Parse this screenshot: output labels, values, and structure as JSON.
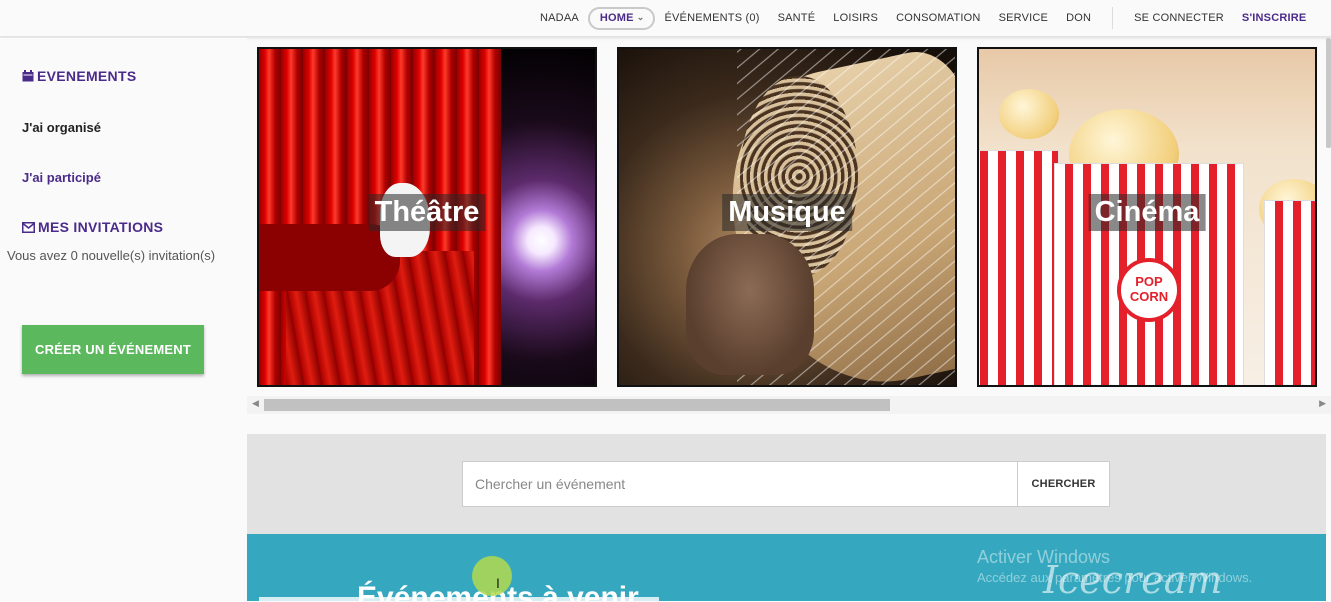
{
  "nav": {
    "brand": "NADAA",
    "home": "HOME",
    "events": "ÉVÉNEMENTS (0)",
    "sante": "SANTÉ",
    "loisirs": "LOISIRS",
    "consomation": "CONSOMATION",
    "service": "SERVICE",
    "don": "DON",
    "login": "SE CONNECTER",
    "signup": "S'INSCRIRE"
  },
  "sidebar": {
    "events_heading": "EVENEMENTS",
    "organised": "J'ai organisé",
    "participated": "J'ai participé",
    "invitations_heading": "MES INVITATIONS",
    "invitations_text": "Vous avez 0 nouvelle(s) invitation(s)",
    "create_button": "CRÉER UN ÉVÉNEMENT"
  },
  "categories": [
    {
      "label": "Théâtre"
    },
    {
      "label": "Musique"
    },
    {
      "label": "Cinéma"
    }
  ],
  "popcorn_label": "POP CORN",
  "search": {
    "placeholder": "Chercher un événement",
    "button": "CHERCHER"
  },
  "upcoming_title": "Événements à venir",
  "os_overlay": {
    "line1": "Activer Windows",
    "line2": "Accédez aux paramètres pour activer Windows."
  },
  "watermark": "Icecream",
  "colors": {
    "accent_purple": "#4b2b8a",
    "create_green": "#5cb85c",
    "teal": "#35a8bf",
    "search_band": "#e2e2e2"
  }
}
